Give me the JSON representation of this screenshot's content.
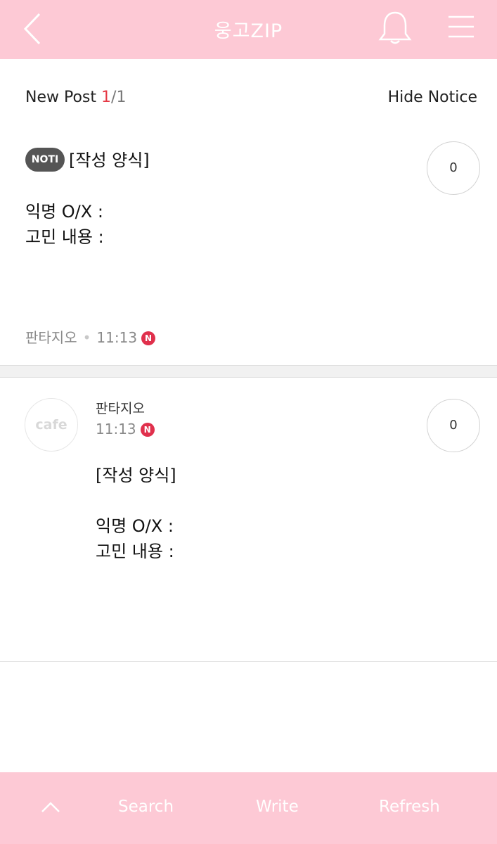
{
  "header": {
    "title": "웅고ZIP",
    "back_icon": "chevron-left-icon",
    "bell_icon": "bell-icon",
    "menu_icon": "hamburger-menu-icon"
  },
  "newpost": {
    "label": "New Post",
    "current": "1",
    "separator": "/",
    "total": "1",
    "hide_notice": "Hide Notice"
  },
  "notice": {
    "badge": "NOTI",
    "title": "[작성 양식]",
    "body": [
      "익명 O/X :",
      "고민 내용 :"
    ],
    "comments": "0",
    "author": "판타지오",
    "time": "11:13",
    "new_badge": "N"
  },
  "post": {
    "avatar": "cafe",
    "author": "판타지오",
    "time": "11:13",
    "new_badge": "N",
    "comments": "0",
    "body": [
      "[작성 양식]",
      "",
      "익명 O/X :",
      "고민 내용 :"
    ]
  },
  "bottom": {
    "up_icon": "chevron-up-icon",
    "search": "Search",
    "write": "Write",
    "refresh": "Refresh"
  },
  "colors": {
    "brand_pink": "#fdc9d5",
    "accent_red": "#e53945",
    "badge_dark": "#555555"
  }
}
